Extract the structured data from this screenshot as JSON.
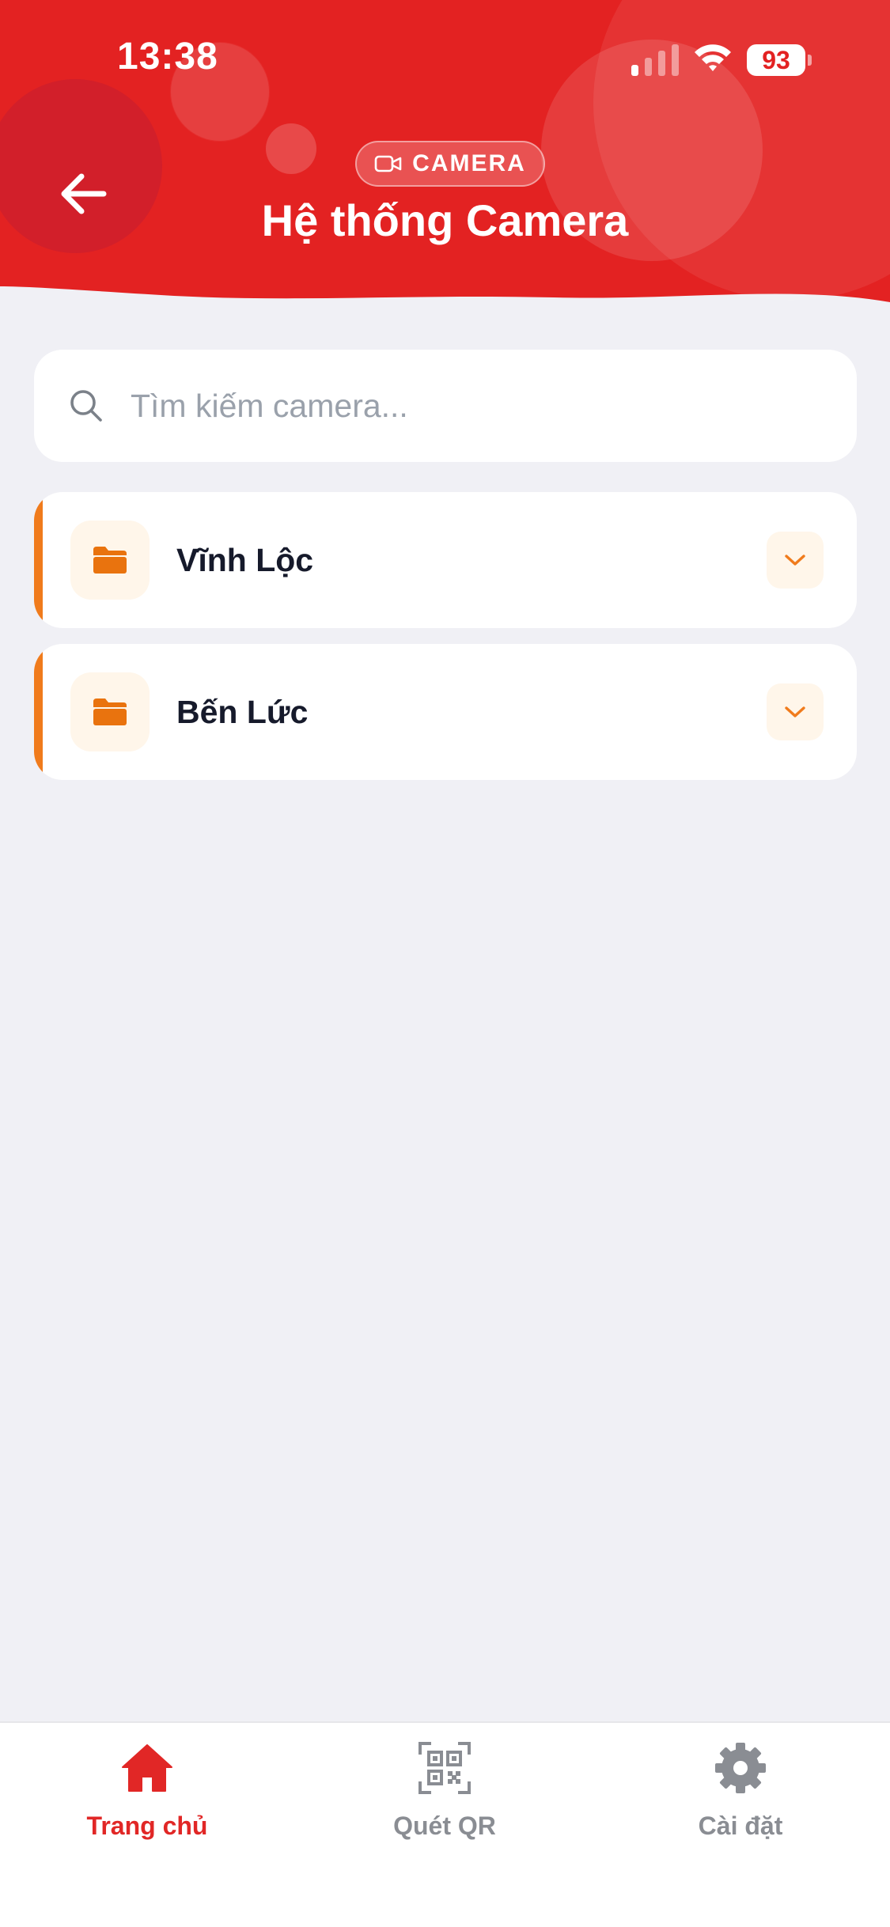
{
  "status_bar": {
    "time": "13:38",
    "battery": "93"
  },
  "header": {
    "badge_label": "CAMERA",
    "title": "Hệ thống Camera",
    "colors": {
      "primary": "#e32222",
      "accent_dark": "#d01e2e"
    }
  },
  "search": {
    "placeholder": "Tìm kiếm camera...",
    "value": ""
  },
  "groups": [
    {
      "name": "Vĩnh Lộc",
      "icon": "folder-icon",
      "expanded": false
    },
    {
      "name": "Bến Lức",
      "icon": "folder-icon",
      "expanded": false
    }
  ],
  "group_accent_color": "#f07b1c",
  "bottom_nav": {
    "items": [
      {
        "label": "Trang chủ",
        "icon": "home-icon",
        "active": true
      },
      {
        "label": "Quét QR",
        "icon": "qr-code-icon",
        "active": false
      },
      {
        "label": "Cài đặt",
        "icon": "gear-icon",
        "active": false
      }
    ],
    "active_color": "#e12726",
    "inactive_color": "#8a8d93"
  }
}
